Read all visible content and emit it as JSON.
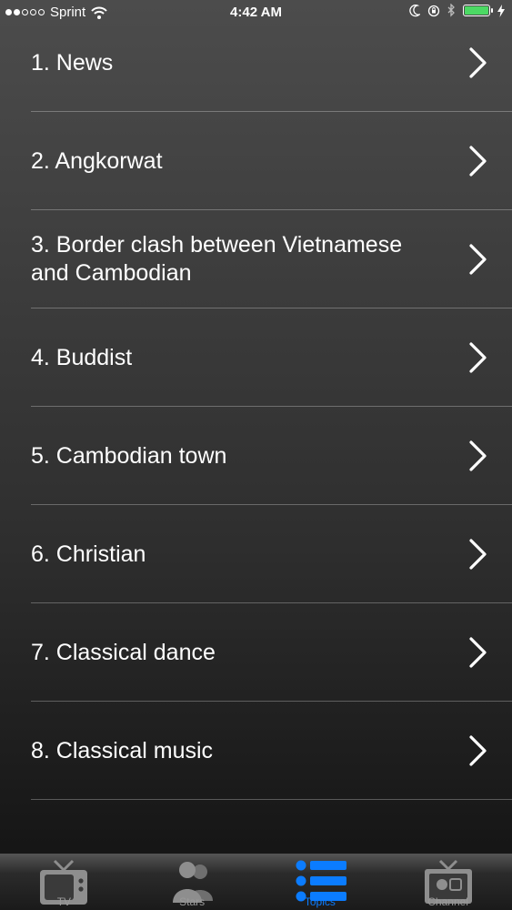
{
  "status_bar": {
    "carrier": "Sprint",
    "time": "4:42 AM",
    "signal_bars_filled": 2,
    "signal_bars_total": 5,
    "battery_color": "#4cd964"
  },
  "topics": [
    {
      "label": "1. News"
    },
    {
      "label": "2. Angkorwat"
    },
    {
      "label": "3. Border clash between Vietnamese and Cambodian"
    },
    {
      "label": "4. Buddist"
    },
    {
      "label": "5. Cambodian town"
    },
    {
      "label": "6. Christian"
    },
    {
      "label": "7. Classical dance"
    },
    {
      "label": "8. Classical music"
    }
  ],
  "tab_bar": {
    "active_color": "#0b7cff",
    "tabs": [
      {
        "label": "TV",
        "icon": "tv-icon"
      },
      {
        "label": "Stars",
        "icon": "people-icon"
      },
      {
        "label": "Topics",
        "icon": "list-icon",
        "active": true
      },
      {
        "label": "Channel",
        "icon": "channel-tv-icon"
      }
    ]
  }
}
